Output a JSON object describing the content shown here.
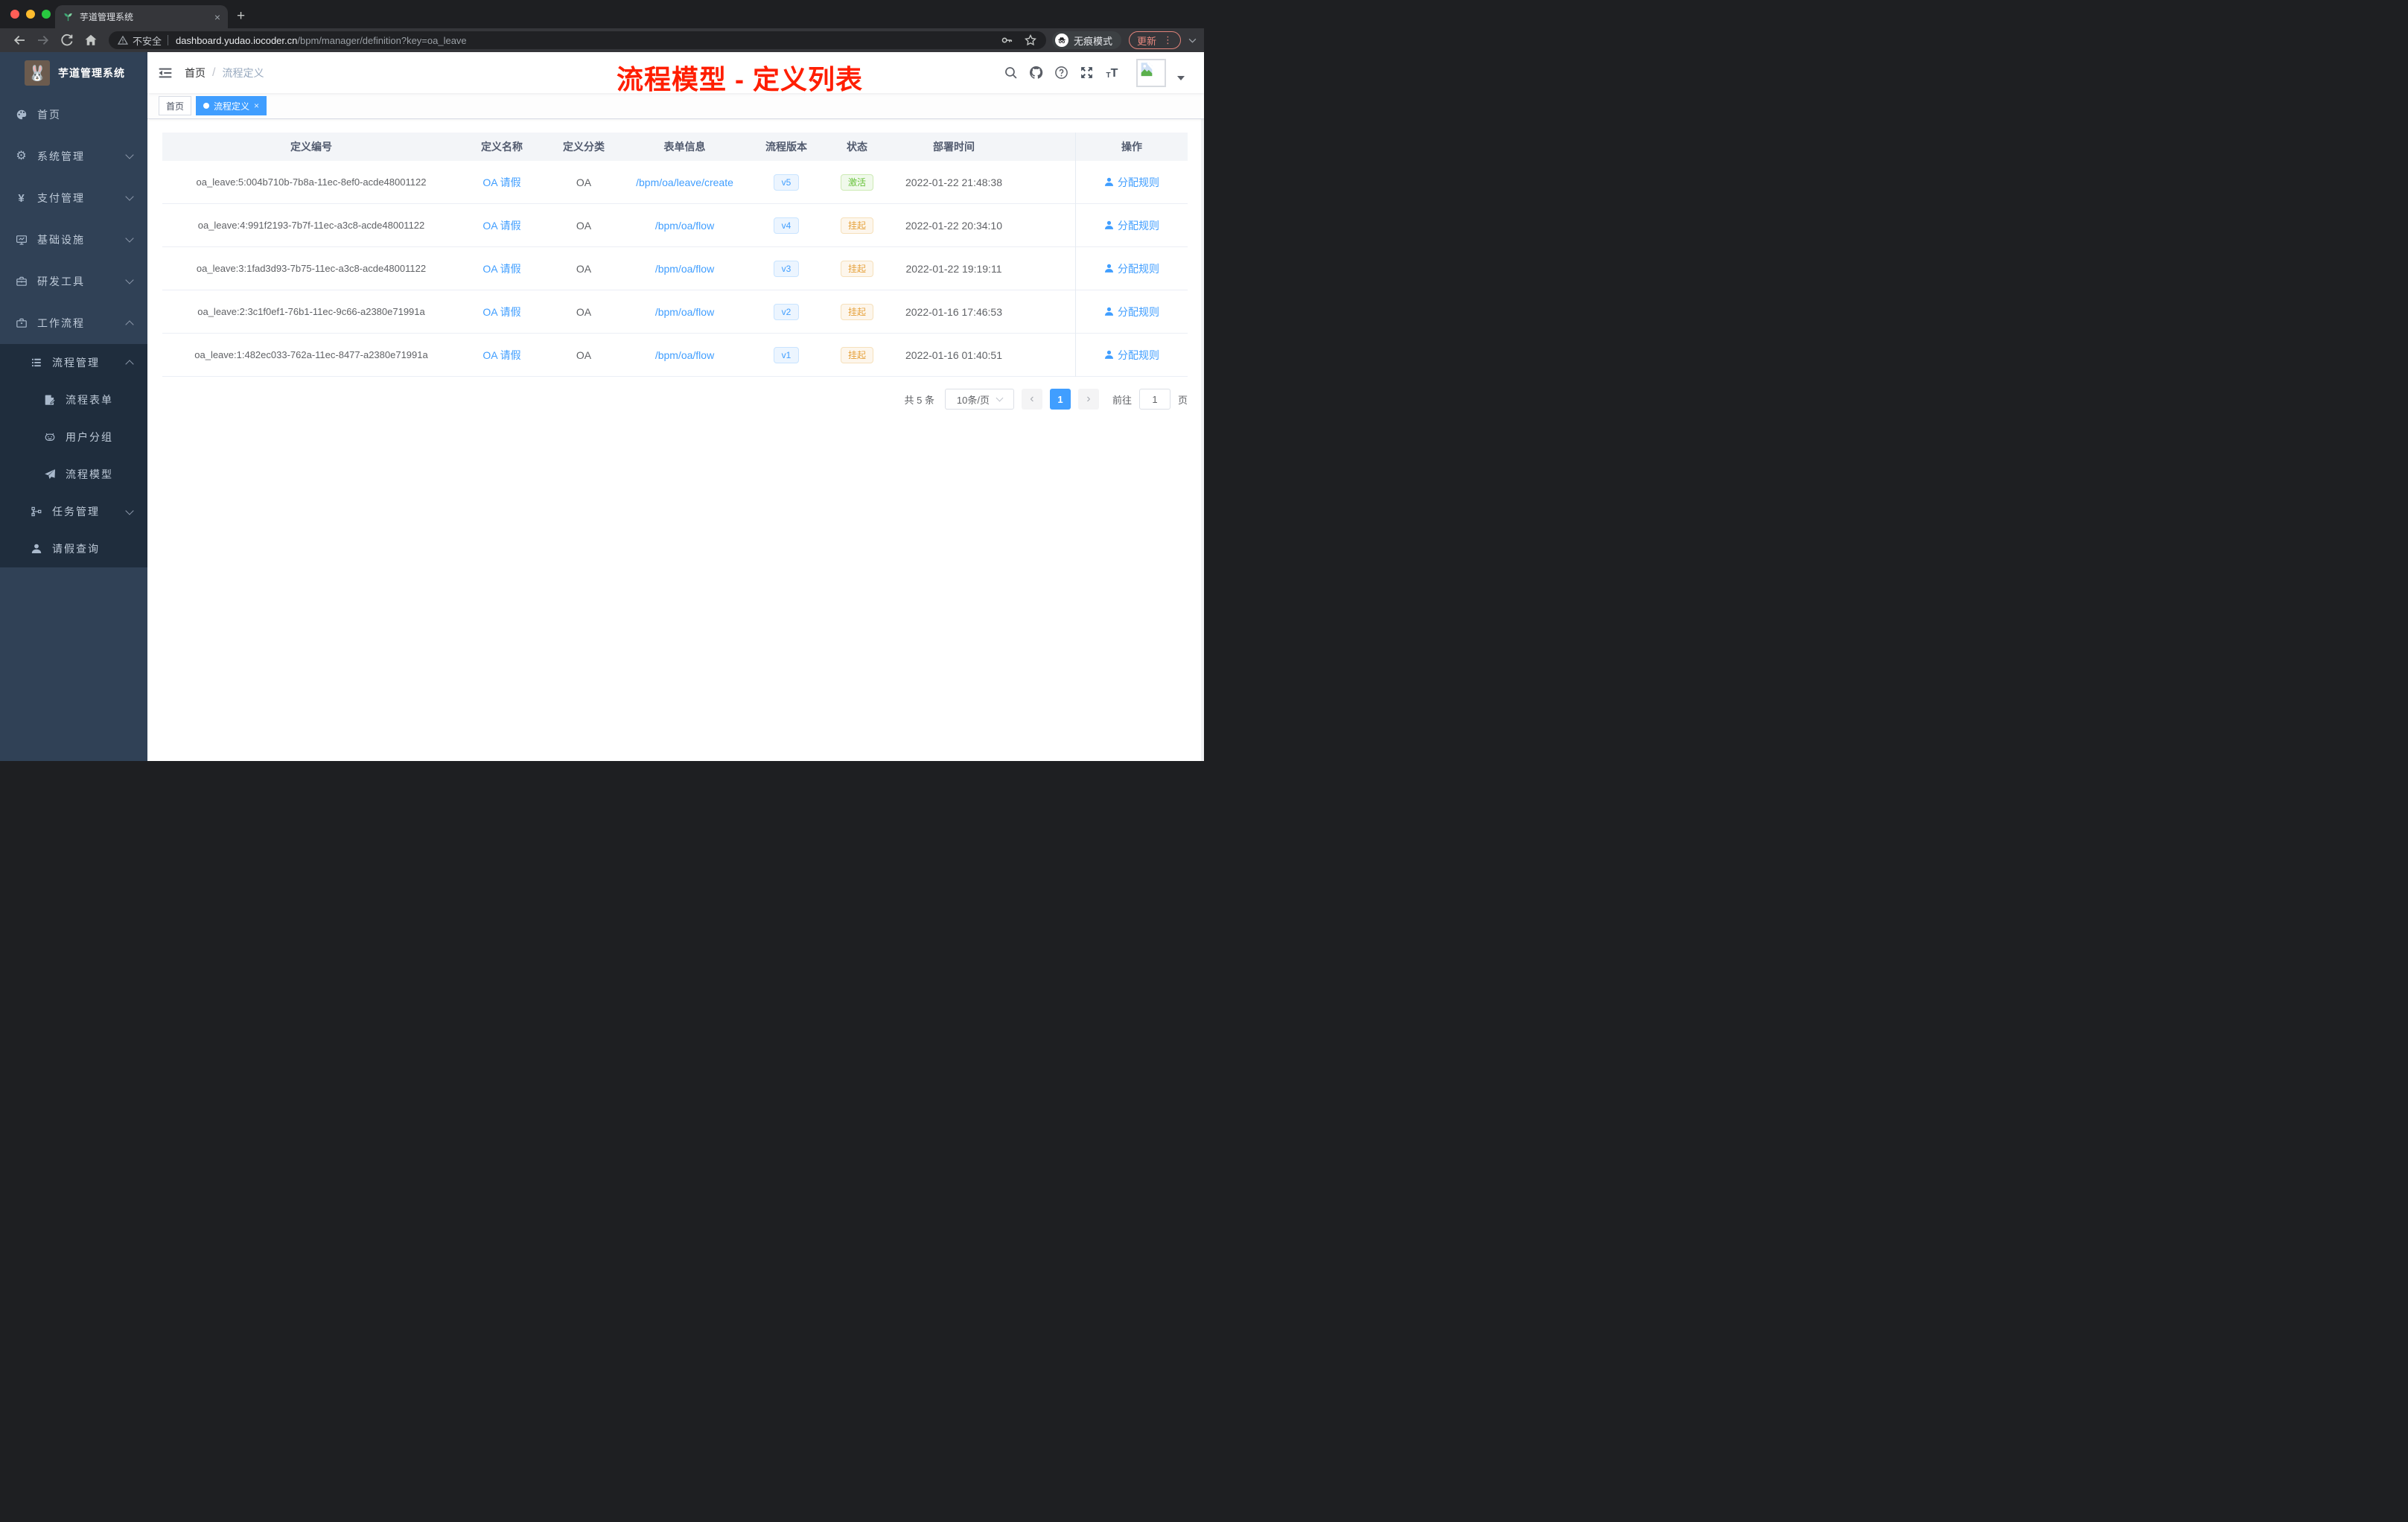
{
  "browser": {
    "tab": {
      "title": "芋道管理系统"
    },
    "address": {
      "security_label": "不安全",
      "url_domain": "dashboard.yudao.iocoder.cn",
      "url_path": "/bpm/manager/definition?key=oa_leave",
      "incognito_label": "无痕模式",
      "update_label": "更新"
    }
  },
  "sidebar": {
    "app_title": "芋道管理系统",
    "menu": [
      {
        "label": "首页",
        "icon": "dashboard-icon"
      },
      {
        "label": "系统管理",
        "icon": "gear-icon",
        "arrow": "down"
      },
      {
        "label": "支付管理",
        "icon": "yen-icon",
        "arrow": "down"
      },
      {
        "label": "基础设施",
        "icon": "monitor-icon",
        "arrow": "down"
      },
      {
        "label": "研发工具",
        "icon": "toolbox-icon",
        "arrow": "down"
      },
      {
        "label": "工作流程",
        "icon": "briefcase-icon",
        "arrow": "up"
      }
    ],
    "submenu": [
      {
        "label": "流程管理",
        "icon": "list-icon",
        "arrow": "up",
        "level": 2
      },
      {
        "label": "流程表单",
        "icon": "form-icon",
        "level": 3
      },
      {
        "label": "用户分组",
        "icon": "robot-icon",
        "level": 3
      },
      {
        "label": "流程模型",
        "icon": "paper-plane-icon",
        "level": 3
      },
      {
        "label": "任务管理",
        "icon": "tree-icon",
        "arrow": "down",
        "level": 2
      },
      {
        "label": "请假查询",
        "icon": "user-icon",
        "level": 2
      }
    ]
  },
  "header": {
    "breadcrumb": [
      "首页",
      "流程定义"
    ],
    "annotation": "流程模型 - 定义列表"
  },
  "tags": [
    {
      "label": "首页",
      "active": false
    },
    {
      "label": "流程定义",
      "active": true,
      "closable": true
    }
  ],
  "table": {
    "columns": [
      "定义编号",
      "定义名称",
      "定义分类",
      "表单信息",
      "流程版本",
      "状态",
      "部署时间",
      "操作"
    ],
    "rows": [
      {
        "id": "oa_leave:5:004b710b-7b8a-11ec-8ef0-acde48001122",
        "name": "OA 请假",
        "category": "OA",
        "form": "/bpm/oa/leave/create",
        "version": "v5",
        "status": "激活",
        "status_type": "success",
        "time": "2022-01-22 21:48:38",
        "action": "分配规则"
      },
      {
        "id": "oa_leave:4:991f2193-7b7f-11ec-a3c8-acde48001122",
        "name": "OA 请假",
        "category": "OA",
        "form": "/bpm/oa/flow",
        "version": "v4",
        "status": "挂起",
        "status_type": "warning",
        "time": "2022-01-22 20:34:10",
        "action": "分配规则"
      },
      {
        "id": "oa_leave:3:1fad3d93-7b75-11ec-a3c8-acde48001122",
        "name": "OA 请假",
        "category": "OA",
        "form": "/bpm/oa/flow",
        "version": "v3",
        "status": "挂起",
        "status_type": "warning",
        "time": "2022-01-22 19:19:11",
        "action": "分配规则"
      },
      {
        "id": "oa_leave:2:3c1f0ef1-76b1-11ec-9c66-a2380e71991a",
        "name": "OA 请假",
        "category": "OA",
        "form": "/bpm/oa/flow",
        "version": "v2",
        "status": "挂起",
        "status_type": "warning",
        "time": "2022-01-16 17:46:53",
        "action": "分配规则"
      },
      {
        "id": "oa_leave:1:482ec033-762a-11ec-8477-a2380e71991a",
        "name": "OA 请假",
        "category": "OA",
        "form": "/bpm/oa/flow",
        "version": "v1",
        "status": "挂起",
        "status_type": "warning",
        "time": "2022-01-16 01:40:51",
        "action": "分配规则"
      }
    ]
  },
  "pagination": {
    "total": "共 5 条",
    "page_size": "10条/页",
    "current": "1",
    "goto_label": "前往",
    "goto_value": "1",
    "unit": "页"
  },
  "colors": {
    "accent": "#409eff",
    "success": "#67c23a",
    "warning": "#e6a23c",
    "annotation_red": "#ff1e00",
    "sidebar_bg": "#304156",
    "submenu_bg": "#1f2d3d"
  }
}
